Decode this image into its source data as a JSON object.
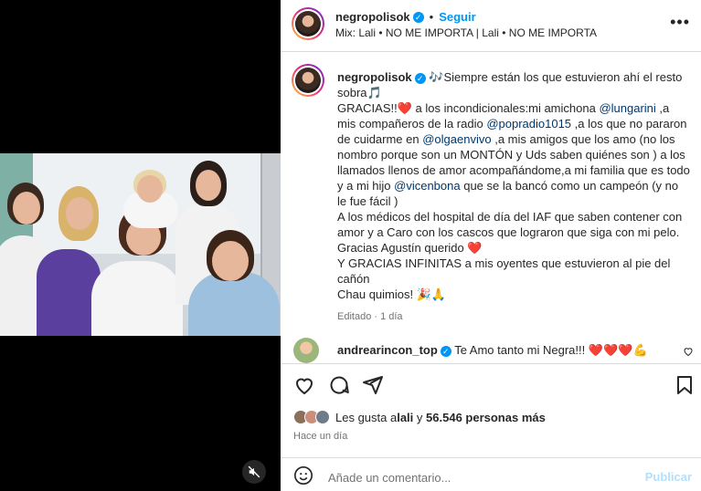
{
  "post": {
    "username": "negropolisok",
    "follow_label": "Seguir",
    "audio": "Mix: Lali • NO ME IMPORTA | Lali • NO ME IMPORTA"
  },
  "caption": {
    "username": "negropolisok",
    "emoji_lead": "🎶",
    "p1": "Siempre están los que estuvieron ahí el resto sobra",
    "p1_emoji": "🎵",
    "p2a": "GRACIAS!!",
    "heart": "❤️",
    "p2b": " a los incondicionales:mi amichona ",
    "m_lungarini": "@lungarini",
    "p2c": " ,a mis compañeros de la radio ",
    "m_popradio": "@popradio1015",
    "p2d": " ,a los que no pararon de cuidarme en ",
    "m_olga": "@olgaenvivo",
    "p2e": " ,a mis amigos que los amo (no los nombro porque son un MONTÓN y Uds saben quiénes son ) a los llamados llenos de amor acompañándome,a mi familia que es todo y a mi hijo ",
    "m_vicen": "@vicenbona",
    "p2f": " que se la bancó como un campeón (y no le fue fácil )",
    "p3": "A los médicos del hospital de día del IAF que saben contener con amor y a Caro con los cascos que lograron que siga con mi pelo.",
    "p4": "Gracias Agustín querido",
    "p5": "Y GRACIAS INFINITAS a mis oyentes que estuvieron al pie del cañón",
    "p6": "Chau quimios!",
    "p6_emoji": "🎉🙏",
    "meta": "Editado · 1 día"
  },
  "comment": {
    "username": "andrearincon_top",
    "text": "Te Amo tanto mi Negra!!!",
    "emoji": "❤️❤️❤️💪"
  },
  "likes": {
    "prefix": "Les gusta a ",
    "user": "lali",
    "middle": " y ",
    "count": "56.546 personas más"
  },
  "time": "Hace un día",
  "add_comment": {
    "placeholder": "Añade un comentario...",
    "post_label": "Publicar"
  },
  "colors": {
    "accent": "#0095f6",
    "mention": "#00376b",
    "secondary_text": "#737373"
  }
}
